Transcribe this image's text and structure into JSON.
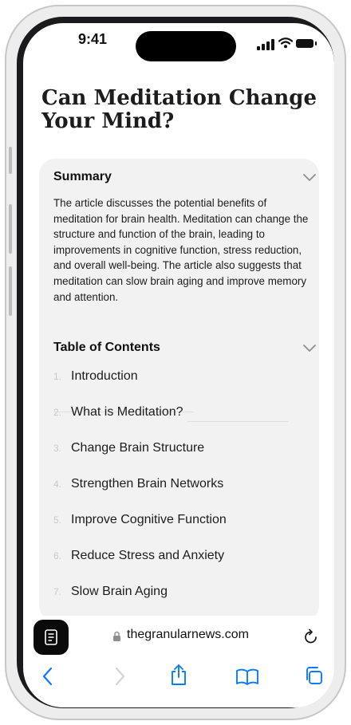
{
  "status": {
    "time": "9:41"
  },
  "article": {
    "title": "Can Meditation Change Your Mind?"
  },
  "summary": {
    "heading": "Summary",
    "text": "The article discusses the potential benefits of meditation for brain health. Meditation can change the structure and function of the brain, leading to improvements in cognitive function, stress reduction, and overall well-being. The article also suggests that meditation can slow brain aging and improve memory and attention."
  },
  "toc": {
    "heading": "Table of Contents",
    "items": [
      {
        "num": "1.",
        "label": "Introduction"
      },
      {
        "num": "2.",
        "label": "What is Meditation?"
      },
      {
        "num": "3.",
        "label": "Change Brain Structure"
      },
      {
        "num": "4.",
        "label": "Strengthen Brain Networks"
      },
      {
        "num": "5.",
        "label": "Improve Cognitive Function"
      },
      {
        "num": "6.",
        "label": "Reduce Stress and Anxiety"
      },
      {
        "num": "7.",
        "label": "Slow Brain Aging"
      }
    ]
  },
  "address_bar": {
    "url": "thegranularnews.com"
  },
  "toolbar": {
    "icons": [
      "back-icon",
      "forward-icon",
      "share-icon",
      "bookmarks-icon",
      "tabs-icon"
    ],
    "accent": "#0a7aff"
  },
  "icons": {
    "reader": "reader-icon",
    "lock": "lock-icon",
    "reload": "reload-icon",
    "chevron": "chevron-down-icon"
  }
}
